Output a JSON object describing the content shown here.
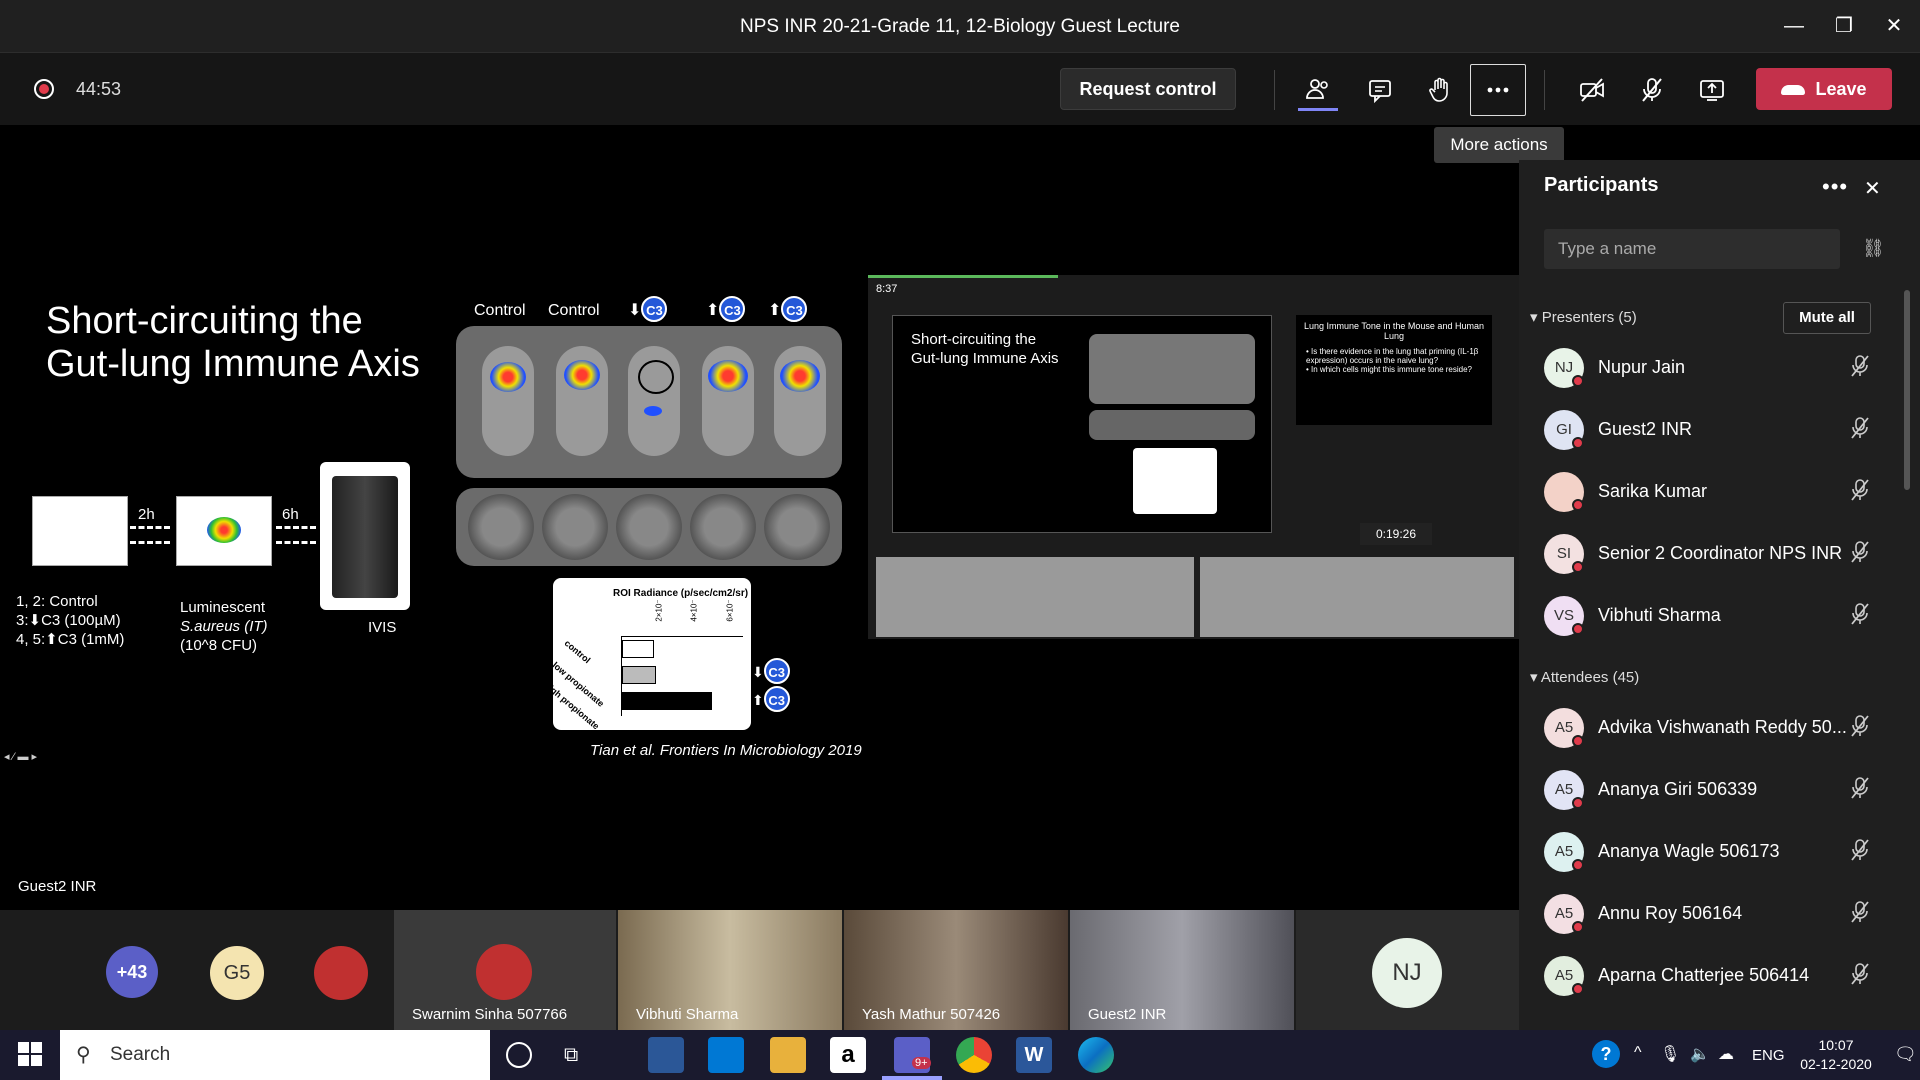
{
  "window": {
    "title": "NPS INR 20-21-Grade 11, 12-Biology Guest Lecture"
  },
  "meeting_bar": {
    "timer": "44:53",
    "request_control_label": "Request control",
    "leave_label": "Leave",
    "tooltip": "More actions"
  },
  "slide": {
    "title": "Short-circuiting the Gut-lung Immune Axis",
    "column_labels": [
      "Control",
      "Control"
    ],
    "badge": "C3",
    "step_labels": [
      "2h",
      "6h"
    ],
    "legend_lines": [
      "1, 2: Control",
      "3:⬇C3 (100µM)",
      "4, 5:⬆C3 (1mM)"
    ],
    "luminescent_lines": [
      "Luminescent",
      "S.aureus (IT)",
      "(10^8 CFU)"
    ],
    "ivis_label": "IVIS",
    "chart": {
      "title": "ROI Radiance (p/sec/cm2/sr)",
      "ticks": [
        "2×10⁻",
        "4×10⁻",
        "6×10⁻"
      ],
      "rows": [
        "control",
        "low propionate",
        "high propionate"
      ]
    },
    "citation": "Tian et al. Frontiers In Microbiology 2019"
  },
  "speaker_label": "Guest2 INR",
  "shared_thumbnail": {
    "time": "8:37",
    "title": "Short-circuiting the Gut-lung Immune Axis",
    "right_title": "Lung Immune Tone in the Mouse and Human Lung",
    "right_bullets": [
      "• Is there evidence in the lung that priming (IL-1β expression) occurs in the naive lung?",
      "• In which cells might this immune tone reside?"
    ],
    "elapsed": "0:19:26"
  },
  "participants": {
    "title": "Participants",
    "search_placeholder": "Type a name",
    "presenters_label": "Presenters (5)",
    "mute_all_label": "Mute all",
    "attendees_label": "Attendees (45)",
    "presenters": [
      {
        "initials": "NJ",
        "name": "Nupur Jain",
        "color": "#e8f3e8"
      },
      {
        "initials": "GI",
        "name": "Guest2 INR",
        "color": "#dfe4f3"
      },
      {
        "initials": "",
        "name": "Sarika Kumar",
        "color": "#f3d2c8"
      },
      {
        "initials": "SI",
        "name": "Senior 2 Coordinator NPS INR",
        "color": "#f3e1e1"
      },
      {
        "initials": "VS",
        "name": "Vibhuti Sharma",
        "color": "#f0dff3"
      }
    ],
    "attendees": [
      {
        "initials": "A5",
        "name": "Advika Vishwanath Reddy 50...",
        "color": "#f3dede"
      },
      {
        "initials": "A5",
        "name": "Ananya Giri 506339",
        "color": "#e2e4f5"
      },
      {
        "initials": "A5",
        "name": "Ananya Wagle 506173",
        "color": "#ddf1f0"
      },
      {
        "initials": "A5",
        "name": "Annu Roy 506164",
        "color": "#f3dfe3"
      },
      {
        "initials": "A5",
        "name": "Aparna Chatterjee 506414",
        "color": "#e2eedf"
      }
    ]
  },
  "gallery": {
    "overflow_count": "+43",
    "g5": "G5",
    "tiles": [
      "Swarnim Sinha 507766",
      "Vibhuti Sharma",
      "Yash Mathur 507426",
      "Guest2 INR"
    ],
    "nj": "NJ"
  },
  "taskbar": {
    "search": "Search",
    "teams_badge": "9+",
    "lang": "ENG",
    "time": "10:07",
    "date": "02-12-2020"
  }
}
